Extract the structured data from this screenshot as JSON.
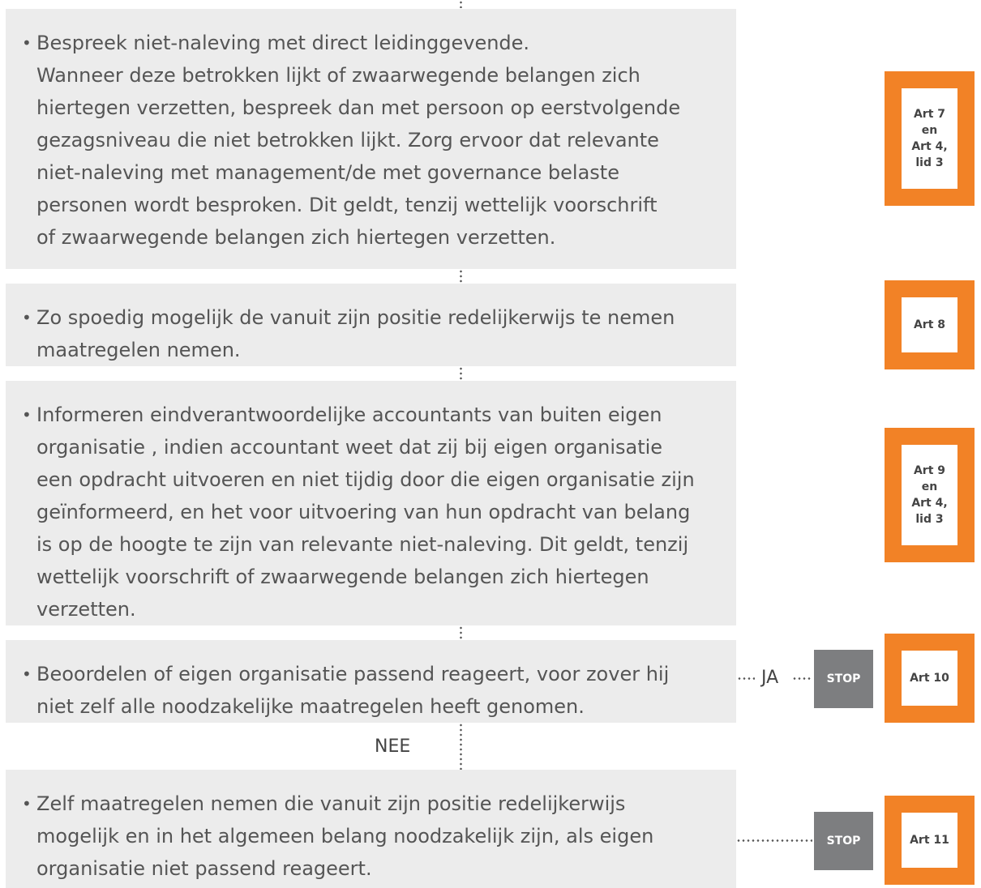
{
  "steps": [
    {
      "lines": [
        "Bespreek niet-naleving met direct leidinggevende.",
        "Wanneer deze betrokken lijkt of zwaarwegende belangen zich",
        "hiertegen verzetten, bespreek dan met persoon op eerstvolgende",
        "gezagsniveau die niet betrokken lijkt. Zorg ervoor dat relevante",
        "niet-naleving met management/de met governance belaste",
        "personen wordt besproken. Dit geldt, tenzij wettelijk voorschrift",
        "of zwaarwegende belangen zich hiertegen verzetten."
      ],
      "article": [
        "Art 7",
        "en",
        "Art 4,",
        "lid 3"
      ]
    },
    {
      "lines": [
        "Zo spoedig mogelijk de vanuit zijn positie redelijkerwijs te nemen",
        "maatregelen nemen."
      ],
      "article": [
        "Art 8"
      ]
    },
    {
      "lines": [
        "Informeren eindverantwoordelijke accountants van buiten eigen",
        "organisatie , indien accountant weet dat zij bij eigen organisatie",
        "een opdracht uitvoeren en niet tijdig door die eigen organisatie zijn",
        "geïnformeerd, en het voor uitvoering van hun opdracht van belang",
        "is op de hoogte te zijn van relevante niet-naleving. Dit geldt, tenzij",
        "wettelijk voorschrift of zwaarwegende belangen zich hiertegen",
        "verzetten."
      ],
      "article": [
        "Art 9",
        "en",
        "Art 4,",
        "lid 3"
      ]
    },
    {
      "lines": [
        "Beoordelen of eigen organisatie passend reageert, voor zover hij",
        "niet zelf alle noodzakelijke maatregelen heeft genomen."
      ],
      "article": [
        "Art 10"
      ]
    },
    {
      "lines": [
        "Zelf maatregelen nemen die vanuit zijn positie redelijkerwijs",
        "mogelijk en in het algemeen belang noodzakelijk zijn, als eigen",
        "organisatie niet passend reageert."
      ],
      "article": [
        "Art 11"
      ]
    }
  ],
  "branch": {
    "yes_label": "JA",
    "no_label": "NEE",
    "stop_label": "STOP"
  },
  "colors": {
    "box_bg": "#ececec",
    "article_frame": "#f28226",
    "stop_bg": "#7d7e80"
  }
}
